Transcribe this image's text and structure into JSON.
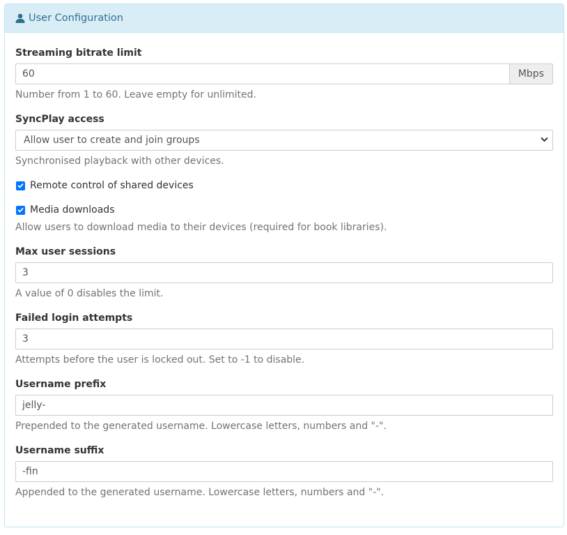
{
  "panel": {
    "title": "User Configuration",
    "icon": "user-icon"
  },
  "bitrate": {
    "label": "Streaming bitrate limit",
    "value": "60",
    "unit": "Mbps",
    "help": "Number from 1 to 60. Leave empty for unlimited."
  },
  "syncplay": {
    "label": "SyncPlay access",
    "selected": "Allow user to create and join groups",
    "help": "Synchronised playback with other devices."
  },
  "remote_control": {
    "label": "Remote control of shared devices",
    "checked": true
  },
  "media_downloads": {
    "label": "Media downloads",
    "checked": true,
    "help": "Allow users to download media to their devices (required for book libraries)."
  },
  "max_sessions": {
    "label": "Max user sessions",
    "value": "3",
    "help": "A value of 0 disables the limit."
  },
  "failed_logins": {
    "label": "Failed login attempts",
    "value": "3",
    "help": "Attempts before the user is locked out. Set to -1 to disable."
  },
  "username_prefix": {
    "label": "Username prefix",
    "value": "jelly-",
    "help": "Prepended to the generated username. Lowercase letters, numbers and \"-\"."
  },
  "username_suffix": {
    "label": "Username suffix",
    "value": "-fin",
    "help": "Appended to the generated username. Lowercase letters, numbers and \"-\"."
  },
  "colors": {
    "heading_bg": "#d9edf7",
    "heading_text": "#31708f",
    "panel_border": "#bce8f1",
    "checkbox_accent": "#0075ff"
  }
}
